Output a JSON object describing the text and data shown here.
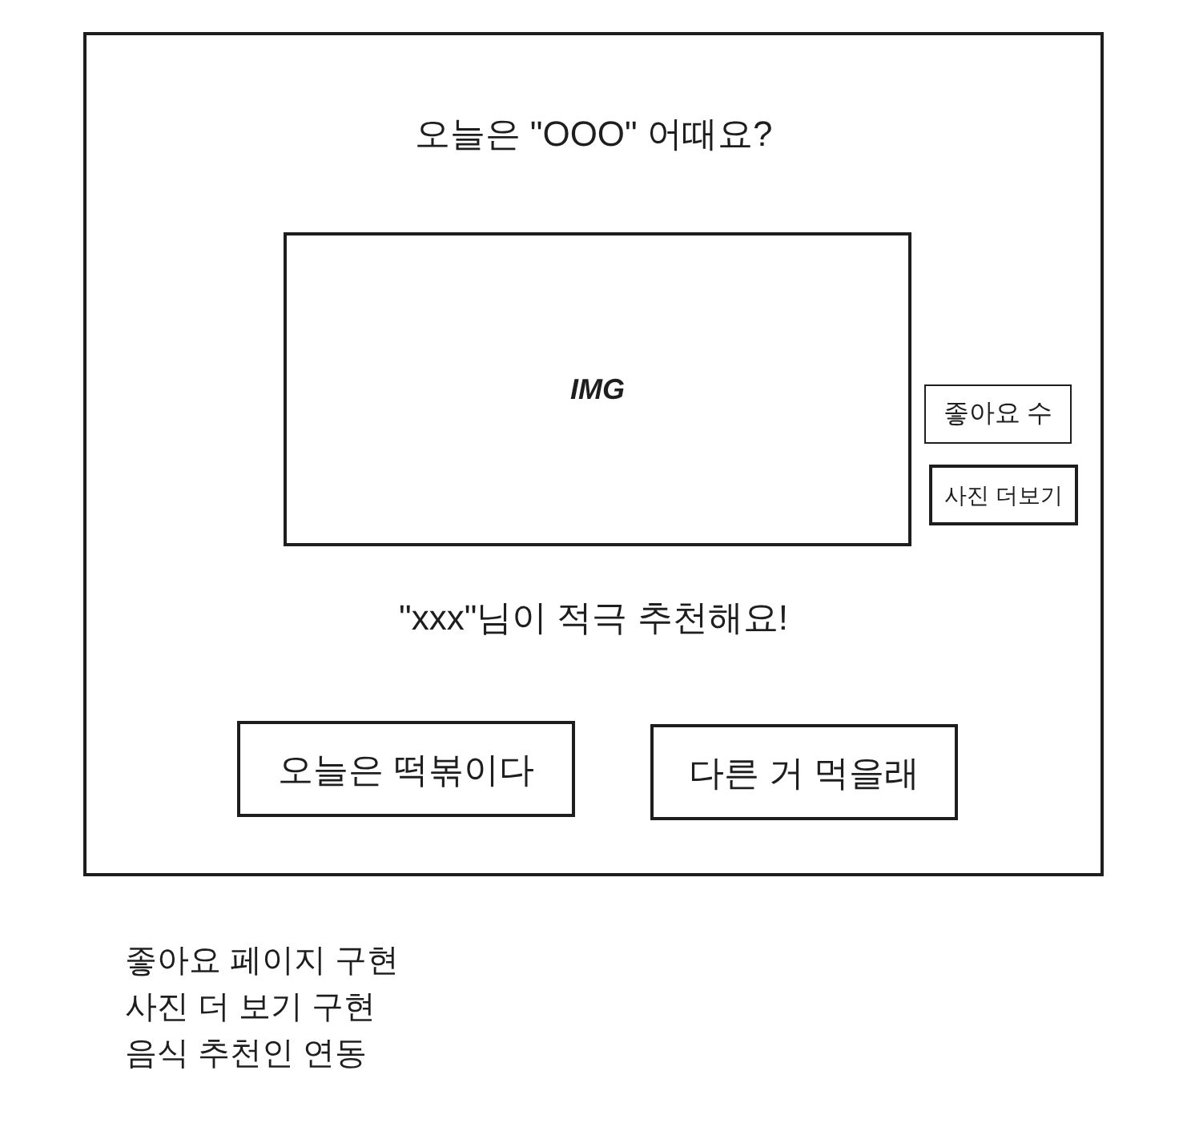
{
  "frame": {
    "title": "오늘은 \"OOO\" 어때요?",
    "image_placeholder": {
      "label": "IMG"
    },
    "side_buttons": [
      "좋아요 수",
      "사진 더보기"
    ],
    "recommendation": "\"xxx\"님이 적극 추천해요!",
    "buttons": [
      "오늘은 떡볶이다",
      "다른 거 먹을래"
    ]
  },
  "notes": [
    "좋아요 페이지 구현",
    "사진 더 보기 구현",
    "음식 추천인 연동"
  ]
}
